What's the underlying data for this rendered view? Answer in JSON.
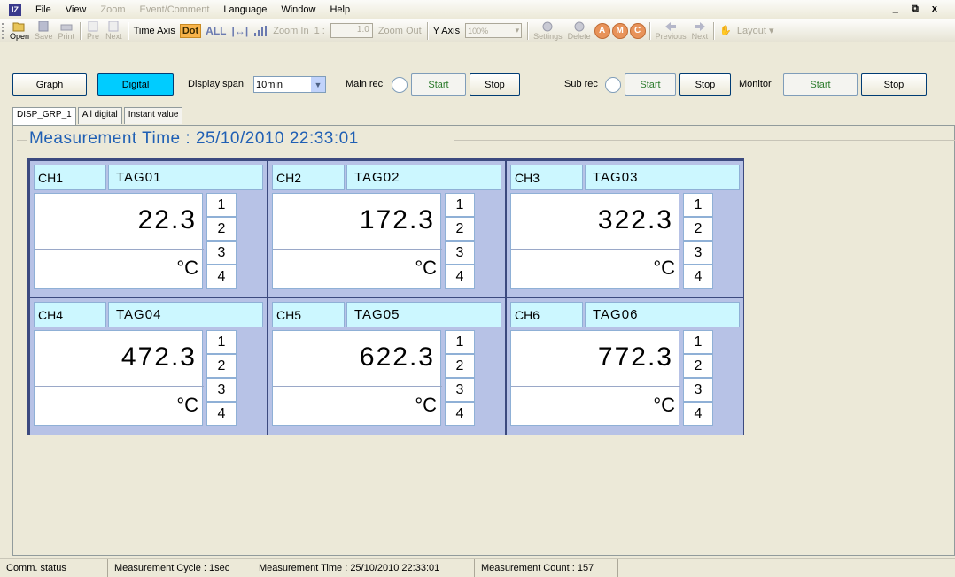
{
  "menu": {
    "items": [
      "File",
      "View",
      "Zoom",
      "Event/Comment",
      "Language",
      "Window",
      "Help"
    ],
    "disabled_items": [
      "Zoom",
      "Event/Comment"
    ],
    "window_controls": "_ ⧉ x"
  },
  "toolbar": {
    "open": "Open",
    "save": "Save",
    "print": "Print",
    "pre": "Pre",
    "next_page": "Next",
    "time_axis": "Time Axis",
    "dot": "Dot",
    "all": "ALL",
    "zoom_in": "Zoom In",
    "zoom_ratio_prefix": "1 :",
    "zoom_value": "1.0",
    "zoom_out": "Zoom Out",
    "y_axis": "Y Axis",
    "y_axis_value": "100%",
    "settings": "Settings",
    "delete": "Delete",
    "marker_a": "A",
    "marker_m": "M",
    "marker_c": "C",
    "previous": "Previous",
    "next": "Next",
    "layout": "Layout ▾"
  },
  "controls": {
    "graph": "Graph",
    "digital": "Digital",
    "display_span_label": "Display span",
    "display_span_value": "10min",
    "main_rec": "Main rec",
    "main_start": "Start",
    "main_stop": "Stop",
    "sub_rec": "Sub rec",
    "sub_start": "Start",
    "sub_stop": "Stop",
    "monitor": "Monitor",
    "monitor_start": "Start",
    "monitor_stop": "Stop"
  },
  "tabs": [
    "DISP_GRP_1",
    "All digital",
    "Instant value"
  ],
  "measurement_time": "Measurement Time : 25/10/2010 22:33:01",
  "channels": [
    {
      "ch": "CH1",
      "tag": "TAG01",
      "value": "22.3",
      "unit": "°C",
      "ind": [
        "1",
        "2",
        "3",
        "4"
      ]
    },
    {
      "ch": "CH2",
      "tag": "TAG02",
      "value": "172.3",
      "unit": "°C",
      "ind": [
        "1",
        "2",
        "3",
        "4"
      ]
    },
    {
      "ch": "CH3",
      "tag": "TAG03",
      "value": "322.3",
      "unit": "°C",
      "ind": [
        "1",
        "2",
        "3",
        "4"
      ]
    },
    {
      "ch": "CH4",
      "tag": "TAG04",
      "value": "472.3",
      "unit": "°C",
      "ind": [
        "1",
        "2",
        "3",
        "4"
      ]
    },
    {
      "ch": "CH5",
      "tag": "TAG05",
      "value": "622.3",
      "unit": "°C",
      "ind": [
        "1",
        "2",
        "3",
        "4"
      ]
    },
    {
      "ch": "CH6",
      "tag": "TAG06",
      "value": "772.3",
      "unit": "°C",
      "ind": [
        "1",
        "2",
        "3",
        "4"
      ]
    }
  ],
  "status": {
    "comm": "Comm. status",
    "cycle": "Measurement Cycle : 1sec",
    "time": "Measurement Time : 25/10/2010 22:33:01",
    "count": "Measurement Count : 157"
  },
  "colors": {
    "active_tab_button": "#00ccff",
    "header_cell": "#ccf7ff",
    "tile_frame": "#b7c2e6",
    "grid_border": "#3c4a7f",
    "measurement_time_text": "#1f5fb4"
  }
}
